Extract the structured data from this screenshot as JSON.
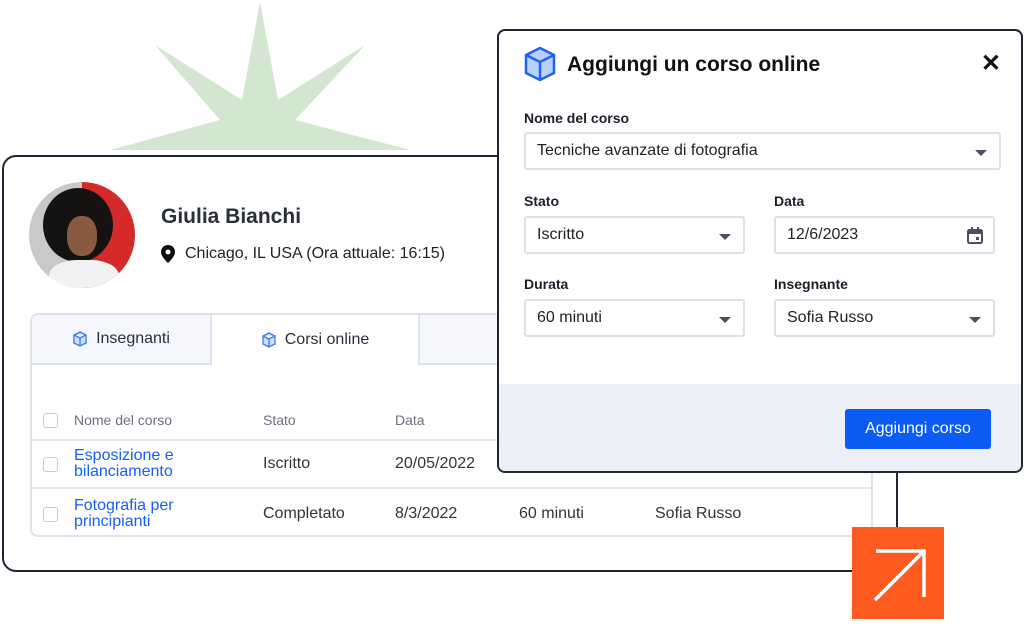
{
  "profile": {
    "name": "Giulia Bianchi",
    "location": "Chicago, IL USA (Ora attuale: 16:15)"
  },
  "tabs": [
    {
      "label": "Insegnanti",
      "icon": "cube-icon"
    },
    {
      "label": "Corsi online",
      "icon": "cube-icon",
      "active": true
    }
  ],
  "table": {
    "headers": [
      "Nome del corso",
      "Stato",
      "Data"
    ],
    "rows": [
      {
        "name_line1": "Esposizione e",
        "name_line2": "bilanciamento",
        "stato": "Iscritto",
        "data": "20/05/2022"
      },
      {
        "name_line1": "Fotografia per",
        "name_line2": "principianti",
        "stato": "Completato",
        "data": "8/3/2022",
        "durata": "60 minuti",
        "insegnante": "Sofia Russo"
      }
    ]
  },
  "modal": {
    "title": "Aggiungi un corso online",
    "fields": {
      "nome": {
        "label": "Nome del corso",
        "value": "Tecniche avanzate di fotografia"
      },
      "stato": {
        "label": "Stato",
        "value": "Iscritto"
      },
      "data": {
        "label": "Data",
        "value": "12/6/2023"
      },
      "durata": {
        "label": "Durata",
        "value": "60 minuti"
      },
      "insegnante": {
        "label": "Insegnante",
        "value": "Sofia Russo"
      }
    },
    "submit_label": "Aggiungi corso"
  },
  "colors": {
    "accent": "#0a5cf5",
    "link": "#1560f0",
    "orange": "#ff5a1f",
    "star": "#d3e6d0"
  }
}
